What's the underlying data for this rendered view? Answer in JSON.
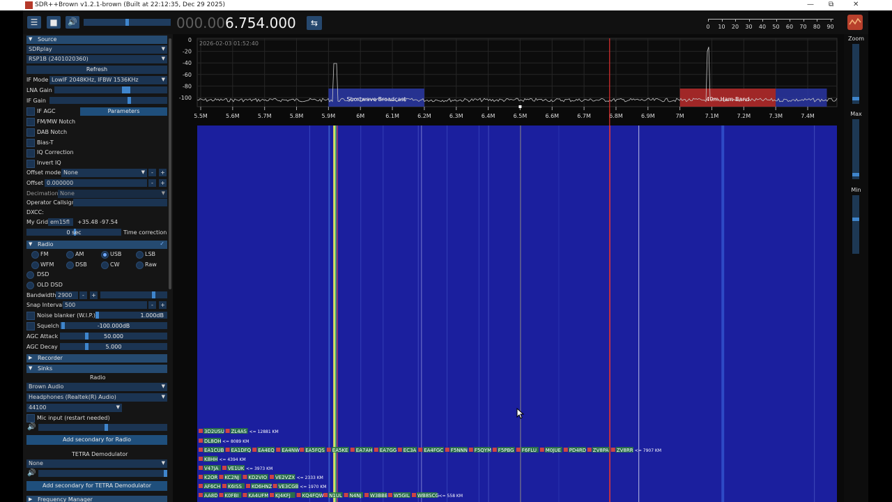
{
  "window": {
    "title": "SDR++Brown v1.2.1-brown (Built at 22:12:35, Dec 29 2025)",
    "min": "—",
    "max": "⧉",
    "close": "✕"
  },
  "toolbar": {
    "menu_icon": "☰",
    "stop_icon": "■",
    "speaker_icon": "🔊",
    "volume": 0.5,
    "freq_dim": "000.00",
    "freq_lit": "6.754.000",
    "swap_icon": "⇆",
    "snr_labels": [
      "0",
      "10",
      "20",
      "30",
      "40",
      "50",
      "60",
      "70",
      "80",
      "90"
    ]
  },
  "source": {
    "header": "Source",
    "device": "SDRplay",
    "serial": "RSP1B (2401020360)",
    "refresh": "Refresh",
    "if_mode_label": "IF Mode",
    "if_mode_value": "LowIF 2048KHz, IFBW 1536KHz",
    "lna_gain_label": "LNA Gain",
    "if_gain_label": "IF Gain",
    "if_agc_label": "IF AGC",
    "parameters": "Parameters",
    "fm_mw_notch": "FM/MW Notch",
    "dab_notch": "DAB Notch",
    "bias_t": "Bias-T",
    "iq_correction": "IQ Correction",
    "invert_iq": "Invert IQ",
    "offset_mode_label": "Offset mode",
    "offset_mode_value": "None",
    "offset_label": "Offset",
    "offset_value": "0.000000",
    "decimation_label": "Decimation",
    "decimation_value": "None",
    "operator_callsign_label": "Operator Callsign",
    "dxcc_label": "DXCC:",
    "my_grid_label": "My Grid",
    "my_grid_value": "em15fl",
    "my_grid_coords": "+35.48 -97.54",
    "time_value": "0 sec",
    "time_correction": "Time correction",
    "minus": "-",
    "plus": "+"
  },
  "radio": {
    "header": "Radio",
    "modes": [
      "FM",
      "AM",
      "USB",
      "LSB",
      "WFM",
      "DSB",
      "CW",
      "Raw"
    ],
    "selected_mode": "USB",
    "dsd": "DSD",
    "old_dsd": "OLD DSD",
    "bandwidth_label": "Bandwidth",
    "bandwidth_value": "2900",
    "snap_label": "Snap Interval",
    "snap_value": "500",
    "noise_blanker_label": "Noise blanker (W.I.P.)",
    "noise_blanker_value": "1.000dB",
    "squelch_label": "Squelch",
    "squelch_value": "-100.000dB",
    "agc_attack_label": "AGC Attack",
    "agc_attack_value": "50.000",
    "agc_decay_label": "AGC Decay",
    "agc_decay_value": "5.000"
  },
  "recorder": {
    "header": "Recorder"
  },
  "sinks": {
    "header": "Sinks",
    "radio_title": "Radio",
    "audio_backend": "Brown Audio",
    "audio_device": "Headphones (Realtek(R) Audio)",
    "sample_rate": "44100",
    "mic_input": "Mic input (restart needed)",
    "add_secondary_radio": "Add secondary for Radio",
    "tetra_title": "TETRA Demodulator",
    "tetra_sink": "None",
    "add_secondary_tetra": "Add secondary for TETRA Demodulator"
  },
  "frequency_manager": {
    "header": "Frequency Manager"
  },
  "spectrum": {
    "timestamp": "2026-02-03 01:52:40",
    "db_labels": [
      "0",
      "-20",
      "-40",
      "-60",
      "-80",
      "-100"
    ],
    "freq_labels": [
      "5.5M",
      "5.6M",
      "5.7M",
      "5.8M",
      "5.9M",
      "6M",
      "6.1M",
      "6.2M",
      "6.3M",
      "6.4M",
      "6.5M",
      "6.6M",
      "6.7M",
      "6.8M",
      "6.9M",
      "7M",
      "7.1M",
      "7.2M",
      "7.3M",
      "7.4M"
    ],
    "band_shortwave": "Shortwave Broadcast",
    "band_40m": "40m Ham Band"
  },
  "right_panel": {
    "zoom": "Zoom",
    "max": "Max",
    "min": "Min"
  },
  "ft8": [
    {
      "calls": [
        "3D2USU",
        "ZL4AS"
      ],
      "dist": "<= 12881 KM"
    },
    {
      "calls": [
        "DL8OH"
      ],
      "dist": "<= 8089 KM"
    },
    {
      "calls": [
        "EA1CUB",
        "EA1DFQ",
        "EA4EQ",
        "EA4NW",
        "EA5FQS",
        "EA5KE",
        "EA7AH",
        "EA7GG",
        "EC3A",
        "EA4FGC",
        "F5NNN",
        "F5QYM",
        "F5PBG",
        "F6FLU",
        "M0JUE",
        "PD4RD",
        "ZV8PA",
        "ZV8RR"
      ],
      "dist": "<= 7907 KM"
    },
    {
      "calls": [
        "K8HH"
      ],
      "dist": "<= 4394 KM"
    },
    {
      "calls": [
        "V47JA",
        "VE1UK"
      ],
      "dist": "<= 3973 KM"
    },
    {
      "calls": [
        "K2OR",
        "KC2NJ",
        "KD2VIO",
        "VE2VZX"
      ],
      "dist": "<= 2333 KM"
    },
    {
      "calls": [
        "AF6CH",
        "K6ISS",
        "KO6HNZ",
        "VE3CGB"
      ],
      "dist": "<= 1970 KM"
    },
    {
      "calls": [
        "AA8D",
        "K0FBI",
        "KA4UFM",
        "KJ4KFJ",
        "KQ4FQW",
        "N1UL",
        "N4NJ",
        "W3BBE",
        "W5GIL",
        "WB8SCG"
      ],
      "dist": "<= 558 KM"
    }
  ],
  "colors": {
    "accent": "#254a70",
    "waterfall_bg": "#1b1f9e",
    "fft_line": "#c8c8c8",
    "shortwave_band": "#2b3aa8",
    "ham_band": "#b02a2a",
    "ham_band_end": "#2a36a5"
  }
}
